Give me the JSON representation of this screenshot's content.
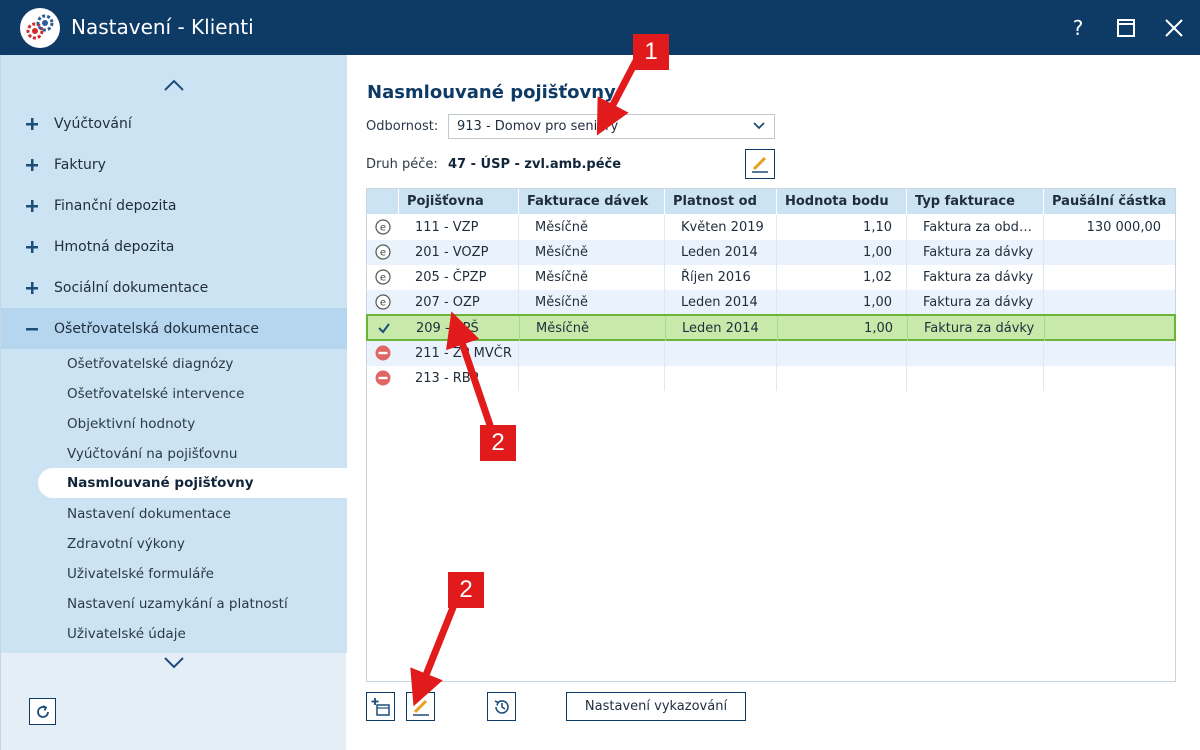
{
  "window": {
    "title": "Nastavení - Klienti",
    "help_label": "?",
    "colors": {
      "titlebar": "#0e3a66",
      "sidebar": "#cce3f4",
      "selected_row": "#c7eaaa",
      "accent_red": "#e11b1b"
    }
  },
  "sidebar": {
    "items": [
      {
        "label": "Vyúčtování",
        "icon": "plus-icon"
      },
      {
        "label": "Faktury",
        "icon": "plus-icon"
      },
      {
        "label": "Finanční depozita",
        "icon": "plus-icon"
      },
      {
        "label": "Hmotná depozita",
        "icon": "plus-icon"
      },
      {
        "label": "Sociální dokumentace",
        "icon": "plus-icon"
      },
      {
        "label": "Ošetřovatelská dokumentace",
        "icon": "minus-icon"
      }
    ],
    "subitems": [
      {
        "label": "Ošetřovatelské diagnózy"
      },
      {
        "label": "Ošetřovatelské intervence"
      },
      {
        "label": "Objektivní hodnoty"
      },
      {
        "label": "Vyúčtování na pojišťovnu"
      },
      {
        "label": "Nasmlouvané pojišťovny",
        "selected": true
      },
      {
        "label": "Nastavení dokumentace"
      },
      {
        "label": "Zdravotní výkony"
      },
      {
        "label": "Uživatelské formuláře"
      },
      {
        "label": "Nastavení uzamykání a platností"
      },
      {
        "label": "Uživatelské údaje"
      }
    ]
  },
  "main": {
    "heading": "Nasmlouvané pojišťovny",
    "specialty_label": "Odbornost:",
    "specialty_value": "913 - Domov pro seniory",
    "care_label": "Druh péče:",
    "care_value": "47 - ÚSP - zvl.amb.péče",
    "table": {
      "columns": [
        "Pojišťovna",
        "Fakturace dávek",
        "Platnost od",
        "Hodnota bodu",
        "Typ fakturace",
        "Paušální částka"
      ],
      "rows": [
        {
          "status": "e-icon",
          "insurer": "111 - VZP",
          "billing": "Měsíčně",
          "valid_from": "Květen 2019",
          "point_value": "1,10",
          "billing_type": "Faktura za obd…",
          "flat_amount": "130 000,00"
        },
        {
          "status": "e-icon",
          "insurer": "201 - VOZP",
          "billing": "Měsíčně",
          "valid_from": "Leden 2014",
          "point_value": "1,00",
          "billing_type": "Faktura za dávky",
          "flat_amount": ""
        },
        {
          "status": "e-icon",
          "insurer": "205 - ČPZP",
          "billing": "Měsíčně",
          "valid_from": "Říjen 2016",
          "point_value": "1,02",
          "billing_type": "Faktura za dávky",
          "flat_amount": ""
        },
        {
          "status": "e-icon",
          "insurer": "207 - OZP",
          "billing": "Měsíčně",
          "valid_from": "Leden 2014",
          "point_value": "1,00",
          "billing_type": "Faktura za dávky",
          "flat_amount": ""
        },
        {
          "status": "check-icon",
          "insurer": "209 - ZPŠ",
          "billing": "Měsíčně",
          "valid_from": "Leden 2014",
          "point_value": "1,00",
          "billing_type": "Faktura za dávky",
          "flat_amount": "",
          "selected": true
        },
        {
          "status": "blocked-icon",
          "insurer": "211 - ZP MVČR",
          "billing": "",
          "valid_from": "",
          "point_value": "",
          "billing_type": "",
          "flat_amount": ""
        },
        {
          "status": "blocked-icon",
          "insurer": "213 - RBP",
          "billing": "",
          "valid_from": "",
          "point_value": "",
          "billing_type": "",
          "flat_amount": ""
        }
      ]
    },
    "report_settings_button": "Nastavení vykazování"
  },
  "annotations": [
    {
      "label": "1"
    },
    {
      "label": "2"
    },
    {
      "label": "2"
    }
  ]
}
